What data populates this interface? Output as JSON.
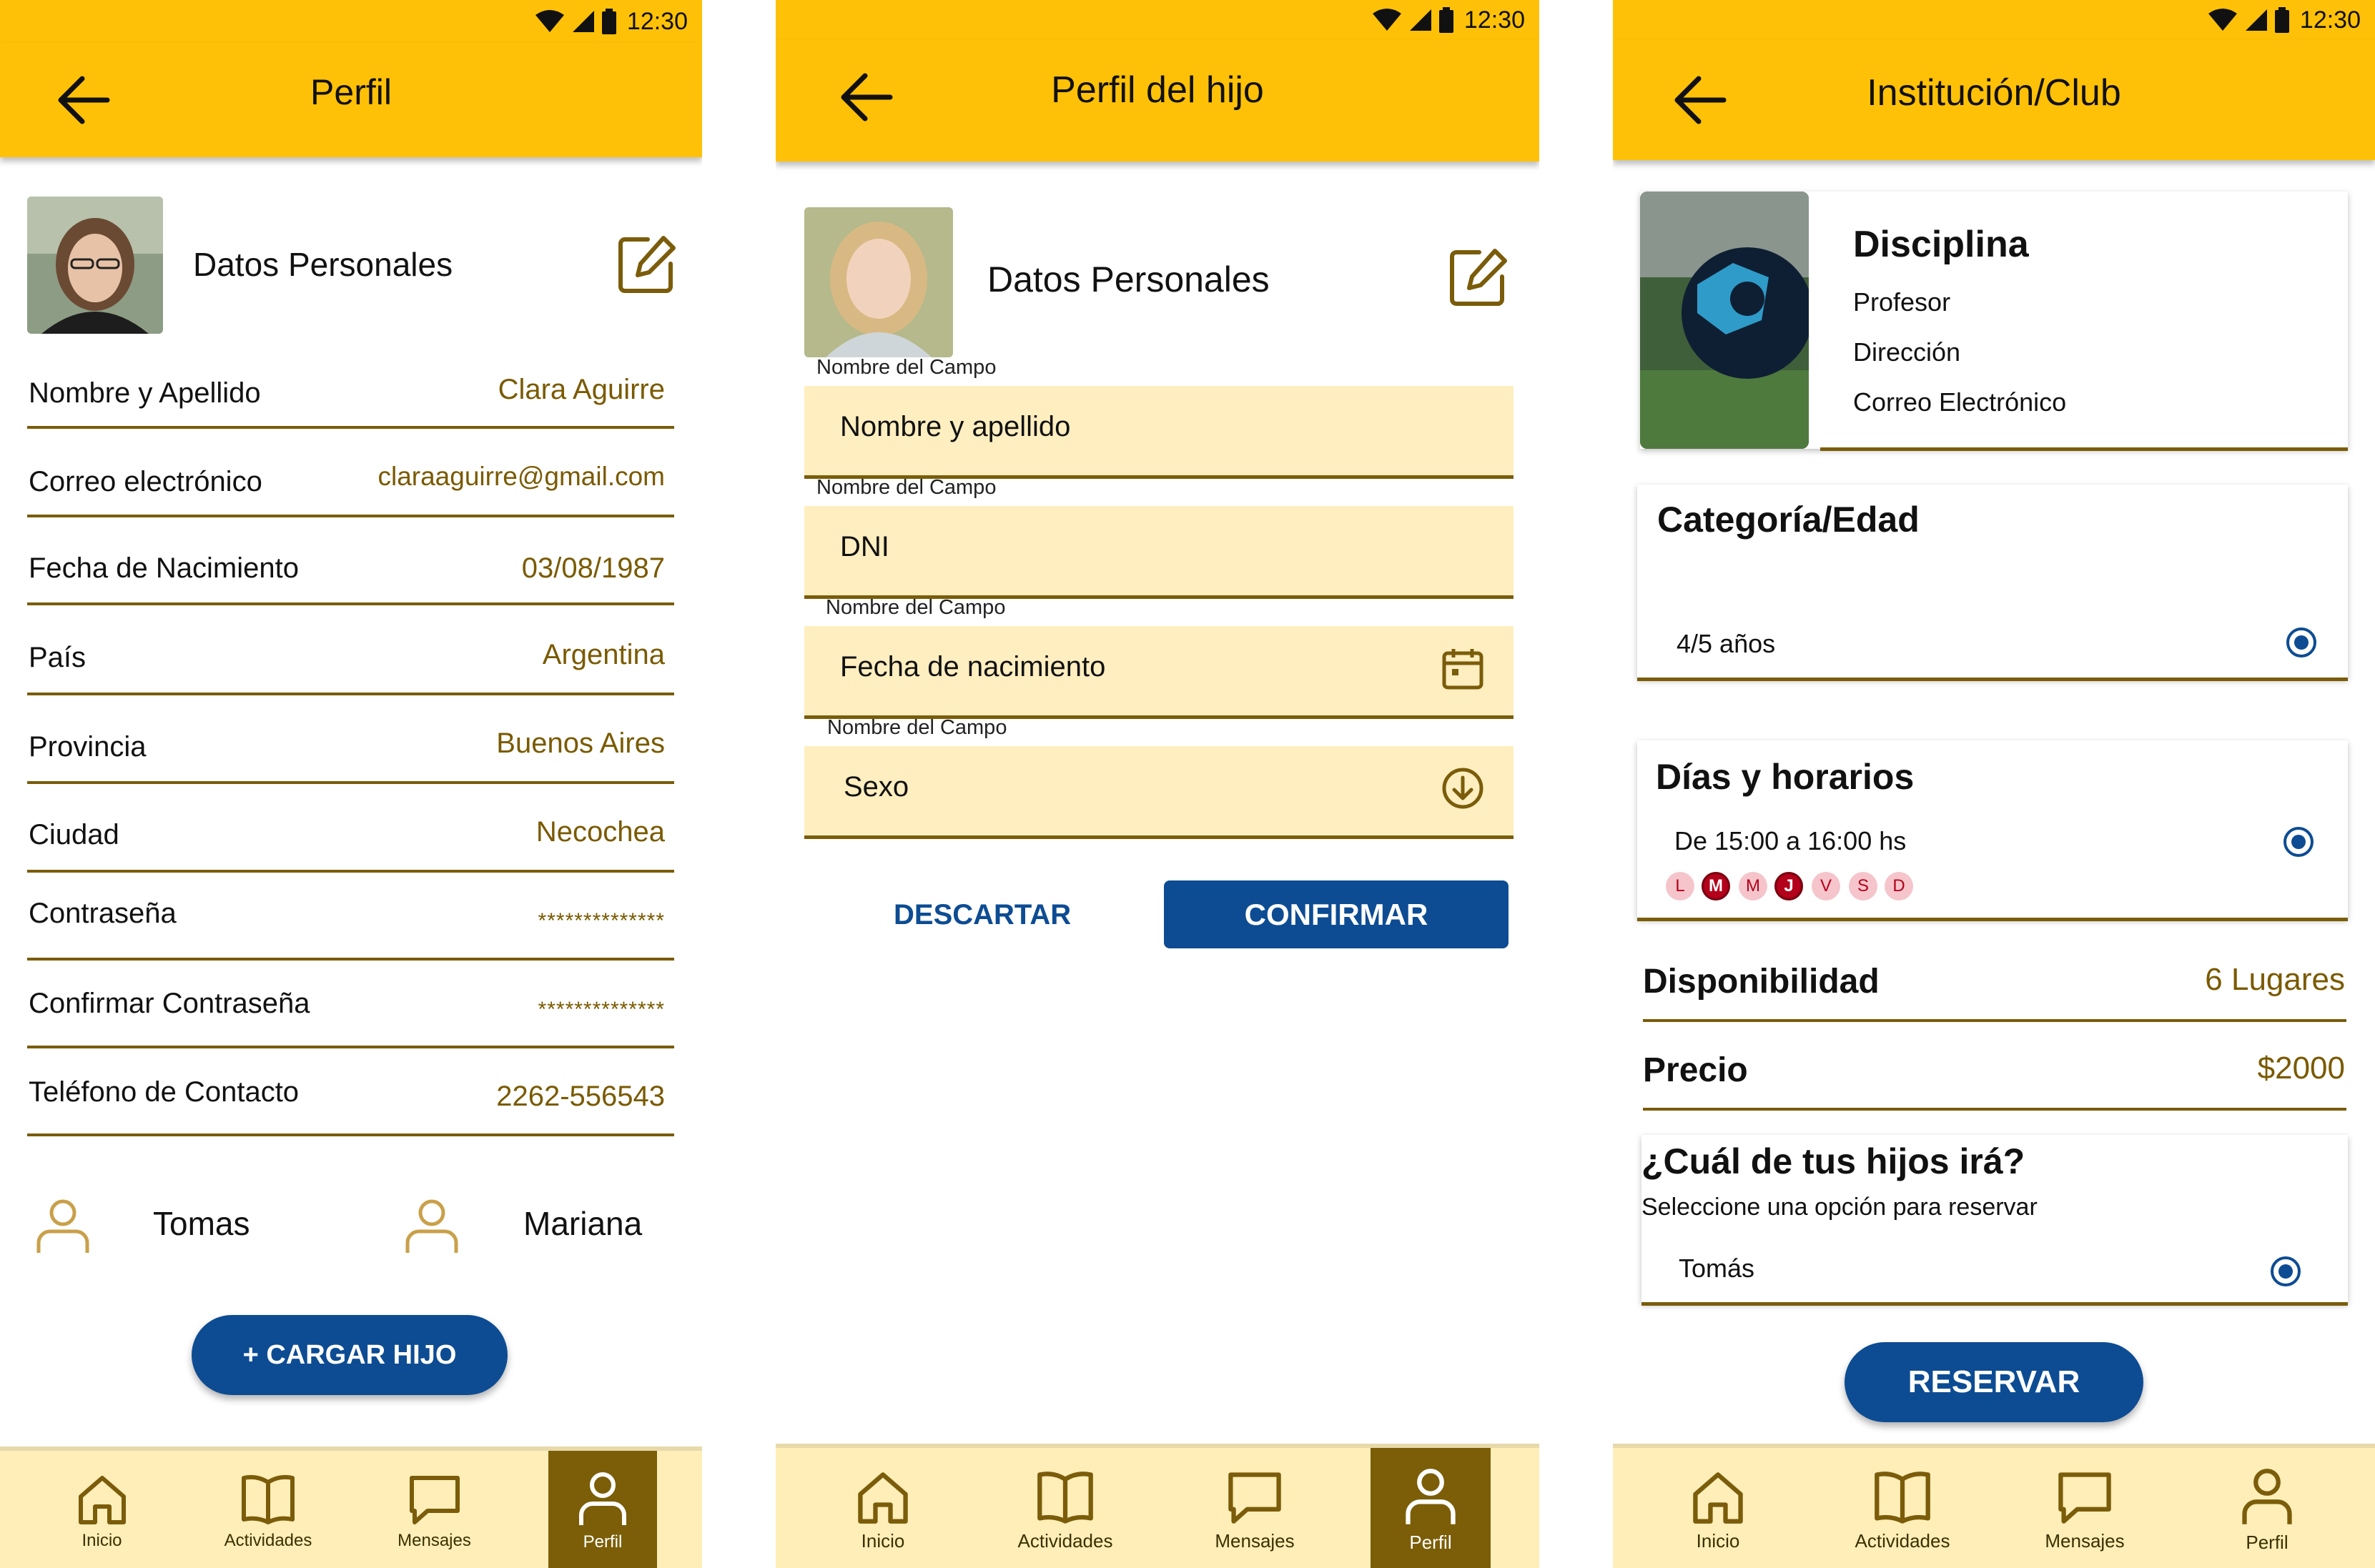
{
  "status": {
    "time": "12:30"
  },
  "screen1": {
    "title": "Perfil",
    "section_title": "Datos Personales",
    "rows": [
      {
        "label": "Nombre y Apellido",
        "value": "Clara Aguirre"
      },
      {
        "label": "Correo electrónico",
        "value": "claraaguirre@gmail.com"
      },
      {
        "label": "Fecha de Nacimiento",
        "value": "03/08/1987"
      },
      {
        "label": "País",
        "value": "Argentina"
      },
      {
        "label": "Provincia",
        "value": "Buenos Aires"
      },
      {
        "label": "Ciudad",
        "value": "Necochea"
      },
      {
        "label": "Contraseña",
        "value": "**************"
      },
      {
        "label": "Confirmar Contraseña",
        "value": "**************"
      },
      {
        "label": "Teléfono de Contacto",
        "value": "2262-556543"
      }
    ],
    "children": [
      "Tomas",
      "Mariana"
    ],
    "add_child_label": "+ CARGAR HIJO"
  },
  "screen2": {
    "title": "Perfil del hijo",
    "section_title": "Datos Personales",
    "fields": [
      {
        "caption": "Nombre del Campo",
        "value": "Nombre y apellido"
      },
      {
        "caption": "Nombre del Campo",
        "value": "DNI"
      },
      {
        "caption": "Nombre del Campo",
        "value": "Fecha de nacimiento"
      },
      {
        "caption": "Nombre del Campo",
        "value": "Sexo"
      }
    ],
    "discard_label": "DESCARTAR",
    "confirm_label": "CONFIRMAR"
  },
  "screen3": {
    "title": "Institución/Club",
    "discipline": {
      "title": "Disciplina",
      "lines": [
        "Profesor",
        "Dirección",
        "Correo Electrónico"
      ]
    },
    "category": {
      "title": "Categoría/Edad",
      "option": "4/5 años"
    },
    "schedule": {
      "title": "Días y horarios",
      "time": "De 15:00 a 16:00 hs",
      "days": [
        {
          "letter": "L",
          "active": false
        },
        {
          "letter": "M",
          "active": true
        },
        {
          "letter": "M",
          "active": false
        },
        {
          "letter": "J",
          "active": true
        },
        {
          "letter": "V",
          "active": false
        },
        {
          "letter": "S",
          "active": false
        },
        {
          "letter": "D",
          "active": false
        }
      ]
    },
    "availability": {
      "label": "Disponibilidad",
      "value": "6 Lugares"
    },
    "price": {
      "label": "Precio",
      "value": "$2000"
    },
    "which_child": {
      "title": "¿Cuál de tus hijos irá?",
      "subtitle": "Seleccione una opción para reservar",
      "option": "Tomás"
    },
    "reserve_label": "RESERVAR"
  },
  "nav": {
    "items": [
      {
        "label": "Inicio",
        "icon": "home-icon"
      },
      {
        "label": "Actividades",
        "icon": "book-icon"
      },
      {
        "label": "Mensajes",
        "icon": "message-icon"
      },
      {
        "label": "Perfil",
        "icon": "person-icon"
      }
    ]
  },
  "colors": {
    "appbar": "#ffc107",
    "accent_gold": "#7a5c0a",
    "field_bg": "#ffeec0",
    "nav_bg": "#ffeeb8",
    "primary_blue": "#0d4c93",
    "day_active": "#b3001b"
  }
}
